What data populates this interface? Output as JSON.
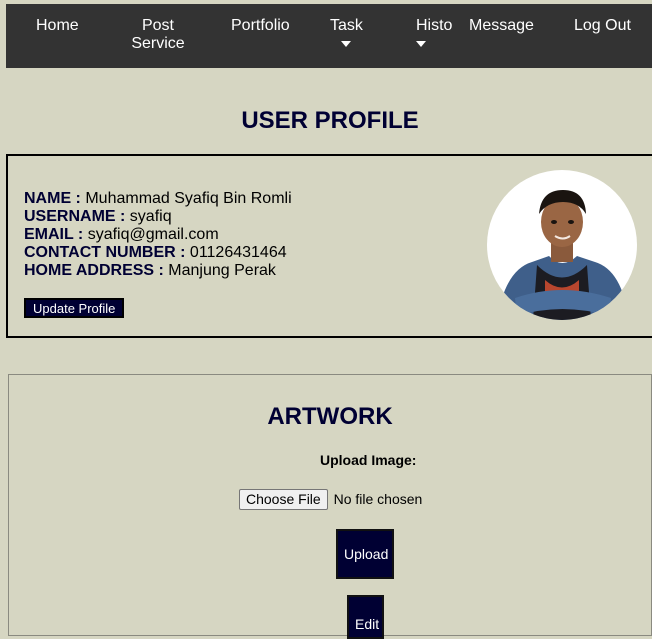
{
  "nav": {
    "home": "Home",
    "post_service_1": "Post",
    "post_service_2": "Service",
    "portfolio": "Portfolio",
    "task": "Task",
    "history": "Histo",
    "message": "Message",
    "logout": "Log Out"
  },
  "profile": {
    "title": "USER PROFILE",
    "name_label": "NAME :",
    "name": " Muhammad Syafiq Bin Romli",
    "username_label": "USERNAME :",
    "username": " syafiq",
    "email_label": "EMAIL :",
    "email": " syafiq@gmail.com",
    "contact_label": "CONTACT NUMBER :",
    "contact": " 01126431464",
    "address_label": "HOME ADDRESS :",
    "address": " Manjung Perak",
    "update_button": "Update Profile"
  },
  "artwork": {
    "title": "ARTWORK",
    "upload_label": "Upload Image:",
    "choose_file": "Choose File",
    "no_file": "No file chosen",
    "upload_button": "Upload",
    "edit_button": "Edit"
  },
  "colors": {
    "background": "#d6d6c2",
    "nav": "#333333",
    "accent": "#000033"
  }
}
